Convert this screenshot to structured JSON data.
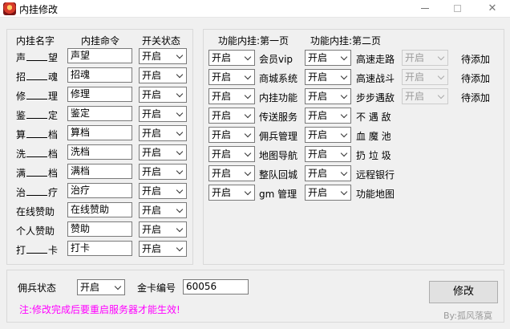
{
  "window": {
    "title": "内挂修改"
  },
  "left_panel": {
    "headers": {
      "name": "内挂名字",
      "command": "内挂命令",
      "status": "开关状态"
    },
    "rows": [
      {
        "name_a": "声",
        "name_b": "望",
        "command": "声望",
        "status": "开启"
      },
      {
        "name_a": "招",
        "name_b": "魂",
        "command": "招魂",
        "status": "开启"
      },
      {
        "name_a": "修",
        "name_b": "理",
        "command": "修理",
        "status": "开启"
      },
      {
        "name_a": "鉴",
        "name_b": "定",
        "command": "鉴定",
        "status": "开启"
      },
      {
        "name_a": "算",
        "name_b": "档",
        "command": "算档",
        "status": "开启"
      },
      {
        "name_a": "洗",
        "name_b": "档",
        "command": "洗档",
        "status": "开启"
      },
      {
        "name_a": "满",
        "name_b": "档",
        "command": "满档",
        "status": "开启"
      },
      {
        "name_a": "治",
        "name_b": "疗",
        "command": "治疗",
        "status": "开启"
      },
      {
        "name": "在线赞助",
        "command": "在线赞助",
        "status": "开启"
      },
      {
        "name": "个人赞助",
        "command": "赞助",
        "status": "开启"
      },
      {
        "name_a": "打",
        "name_b": "卡",
        "command": "打卡",
        "status": "开启"
      }
    ]
  },
  "right_panel": {
    "page1_header": "功能内挂:第一页",
    "page2_header": "功能内挂:第二页",
    "page1": [
      {
        "status": "开启",
        "label": "会员vip"
      },
      {
        "status": "开启",
        "label": "商城系统"
      },
      {
        "status": "开启",
        "label": "内挂功能"
      },
      {
        "status": "开启",
        "label": "传送服务"
      },
      {
        "status": "开启",
        "label": "佣兵管理"
      },
      {
        "status": "开启",
        "label": "地图导航"
      },
      {
        "status": "开启",
        "label": "整队回城"
      },
      {
        "status": "开启",
        "label": "gm 管理"
      }
    ],
    "page2": [
      {
        "status": "开启",
        "label": "高速走路"
      },
      {
        "status": "开启",
        "label": "高速战斗"
      },
      {
        "status": "开启",
        "label": "步步遇敌"
      },
      {
        "status": "开启",
        "label": "不 遇 敌"
      },
      {
        "status": "开启",
        "label": "血 魔 池"
      },
      {
        "status": "开启",
        "label": "扔 垃 圾"
      },
      {
        "status": "开启",
        "label": "远程银行"
      },
      {
        "status": "开启",
        "label": "功能地图"
      }
    ],
    "extra": [
      {
        "status": "开启",
        "label": "待添加"
      },
      {
        "status": "开启",
        "label": "待添加"
      },
      {
        "status": "开启",
        "label": "待添加"
      }
    ]
  },
  "bottom": {
    "mercenary_label": "佣兵状态",
    "mercenary_status": "开启",
    "card_label": "金卡编号",
    "card_value": "60056",
    "edit_button": "修改",
    "notice": "注:修改完成后要重启服务器才能生效!",
    "credit": "By:孤风落寞"
  }
}
